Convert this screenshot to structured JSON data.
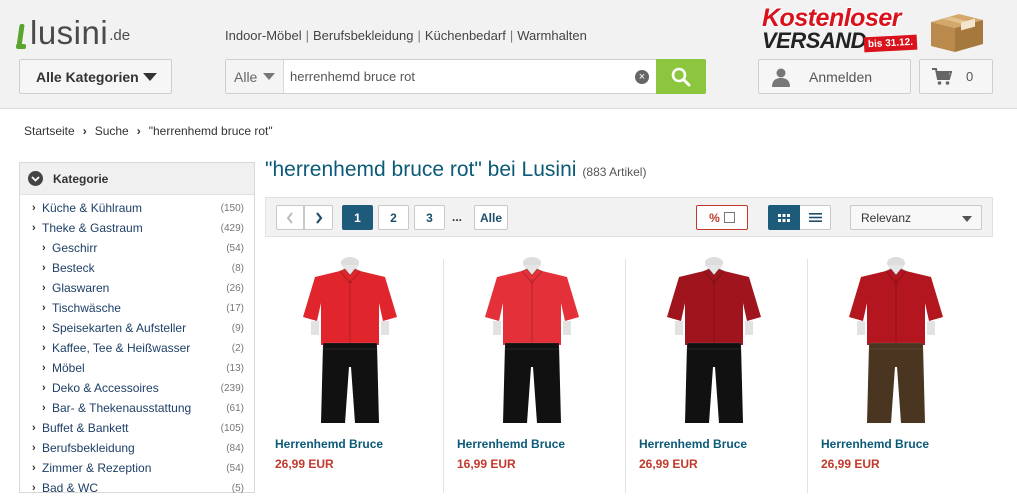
{
  "brand": {
    "logo_text": "lusini",
    "logo_tld": ".de",
    "accent": "#5aa52e"
  },
  "top_nav": {
    "links": [
      "Indoor-Möbel",
      "Berufsbekleidung",
      "Küchenbedarf",
      "Warmhalten"
    ],
    "separator": "|"
  },
  "promo": {
    "line1": "Kostenloser",
    "line2": "VERSAND",
    "badge": "bis 31.12."
  },
  "categories_button": {
    "label": "Alle Kategorien",
    "icon": "chevron-down-icon"
  },
  "search": {
    "scope_label": "Alle",
    "value": "herrenhemd bruce rot",
    "clear_icon": "clear-icon",
    "submit_icon": "search-icon",
    "submit_color": "#8cc63f"
  },
  "account": {
    "login_label": "Anmelden",
    "login_icon": "user-icon",
    "cart_icon": "cart-icon",
    "cart_count": "0"
  },
  "breadcrumb": [
    "Startseite",
    "Suche",
    "\"herrenhemd bruce rot\""
  ],
  "sidebar": {
    "title": "Kategorie",
    "items": [
      {
        "label": "Küche & Kühlraum",
        "count": "(150)",
        "level": 1
      },
      {
        "label": "Theke & Gastraum",
        "count": "(429)",
        "level": 1
      },
      {
        "label": "Geschirr",
        "count": "(54)",
        "level": 2
      },
      {
        "label": "Besteck",
        "count": "(8)",
        "level": 2
      },
      {
        "label": "Glaswaren",
        "count": "(26)",
        "level": 2
      },
      {
        "label": "Tischwäsche",
        "count": "(17)",
        "level": 2
      },
      {
        "label": "Speisekarten & Aufsteller",
        "count": "(9)",
        "level": 2
      },
      {
        "label": "Kaffee, Tee & Heißwasser",
        "count": "(2)",
        "level": 2
      },
      {
        "label": "Möbel",
        "count": "(13)",
        "level": 2
      },
      {
        "label": "Deko & Accessoires",
        "count": "(239)",
        "level": 2
      },
      {
        "label": "Bar- & Thekenausstattung",
        "count": "(61)",
        "level": 2
      },
      {
        "label": "Buffet & Bankett",
        "count": "(105)",
        "level": 1
      },
      {
        "label": "Berufsbekleidung",
        "count": "(84)",
        "level": 1
      },
      {
        "label": "Zimmer & Rezeption",
        "count": "(54)",
        "level": 1
      },
      {
        "label": "Bad & WC",
        "count": "(5)",
        "level": 1
      }
    ]
  },
  "results": {
    "query_title": "\"herrenhemd bruce rot\" bei Lusini",
    "count_label": "(883 Artikel)"
  },
  "toolbar": {
    "pages": [
      "1",
      "2",
      "3"
    ],
    "current_page": "1",
    "ellipsis": "...",
    "all_label": "Alle",
    "discount_label": "%",
    "sort_label": "Relevanz",
    "active_color": "#1e5a7a"
  },
  "products": [
    {
      "name": "Herrenhemd Bruce",
      "price": "26,99 EUR",
      "shirt_color": "#e0262c",
      "pants_color": "#111111"
    },
    {
      "name": "Herrenhemd Bruce",
      "price": "16,99 EUR",
      "shirt_color": "#e43038",
      "pants_color": "#111111"
    },
    {
      "name": "Herrenhemd Bruce",
      "price": "26,99 EUR",
      "shirt_color": "#a0141d",
      "pants_color": "#111111"
    },
    {
      "name": "Herrenhemd Bruce",
      "price": "26,99 EUR",
      "shirt_color": "#b3161f",
      "pants_color": "#4a3520"
    }
  ]
}
